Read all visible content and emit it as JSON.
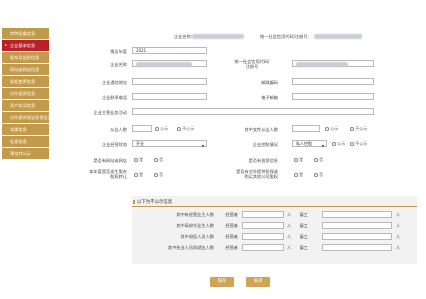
{
  "sidebar": {
    "items": [
      {
        "label": "特种设备信息",
        "active": false
      },
      {
        "label": "企业基本信息",
        "active": true
      },
      {
        "label": "股东及出资信息",
        "active": false
      },
      {
        "label": "网站或网店信息",
        "active": false
      },
      {
        "label": "股权变更信息",
        "active": false
      },
      {
        "label": "对外投资信息",
        "active": false
      },
      {
        "label": "资产状况信息",
        "active": false
      },
      {
        "label": "对外提供保证担保信息",
        "active": false
      },
      {
        "label": "党建信息",
        "active": false
      },
      {
        "label": "社保信息",
        "active": false
      },
      {
        "label": "预览并公示",
        "active": false
      }
    ]
  },
  "header": {
    "company_name_label": "企业名称：",
    "credit_code_label": "统一社会信用代码/注册号："
  },
  "form": {
    "report_year_label": "报告年度",
    "report_year_value": "2021",
    "company_name_label": "企业名称",
    "credit_code_label": "统一社会信用代码/\n注册号",
    "phone_label": "企业通信地址",
    "postcode_label": "邮政编码",
    "contact_phone_label": "企业联系电话",
    "email_label": "电子邮箱",
    "business_scope_label": "企业主营业务活动",
    "employees_label": "从业人数",
    "female_employees_label": "其中女性从业人数",
    "status_label": "企业经营状态",
    "status_value": "开业",
    "holding_label": "企业控股情况",
    "holding_value": "私人控股",
    "website_label": "是否有网站或网店",
    "equity_transfer_label": "是否有投资信息",
    "invest_label": "本年度是否发生股东\n股权转让",
    "guarantee_label": "是否有对外提供担保或\n购买其他公司股权",
    "public_label": "公示",
    "nonpublic_label": "不公示",
    "yes_label": "是",
    "no_label": "否"
  },
  "section": {
    "title": "以下为不公示信息",
    "rows": [
      {
        "label": "其中有经营业主人数"
      },
      {
        "label": "其中高校毕业生人数"
      },
      {
        "label": "其中退役人员人数"
      },
      {
        "label": "其中失业人员再就业人数"
      }
    ],
    "manager_label": "经营者",
    "employee_label": "雇工",
    "unit": "人"
  },
  "buttons": {
    "save": "保存",
    "close": "关闭"
  },
  "colors": {
    "sidebar": "#c19a4b",
    "sidebar_active": "#b8202a",
    "button": "#d0a455"
  }
}
